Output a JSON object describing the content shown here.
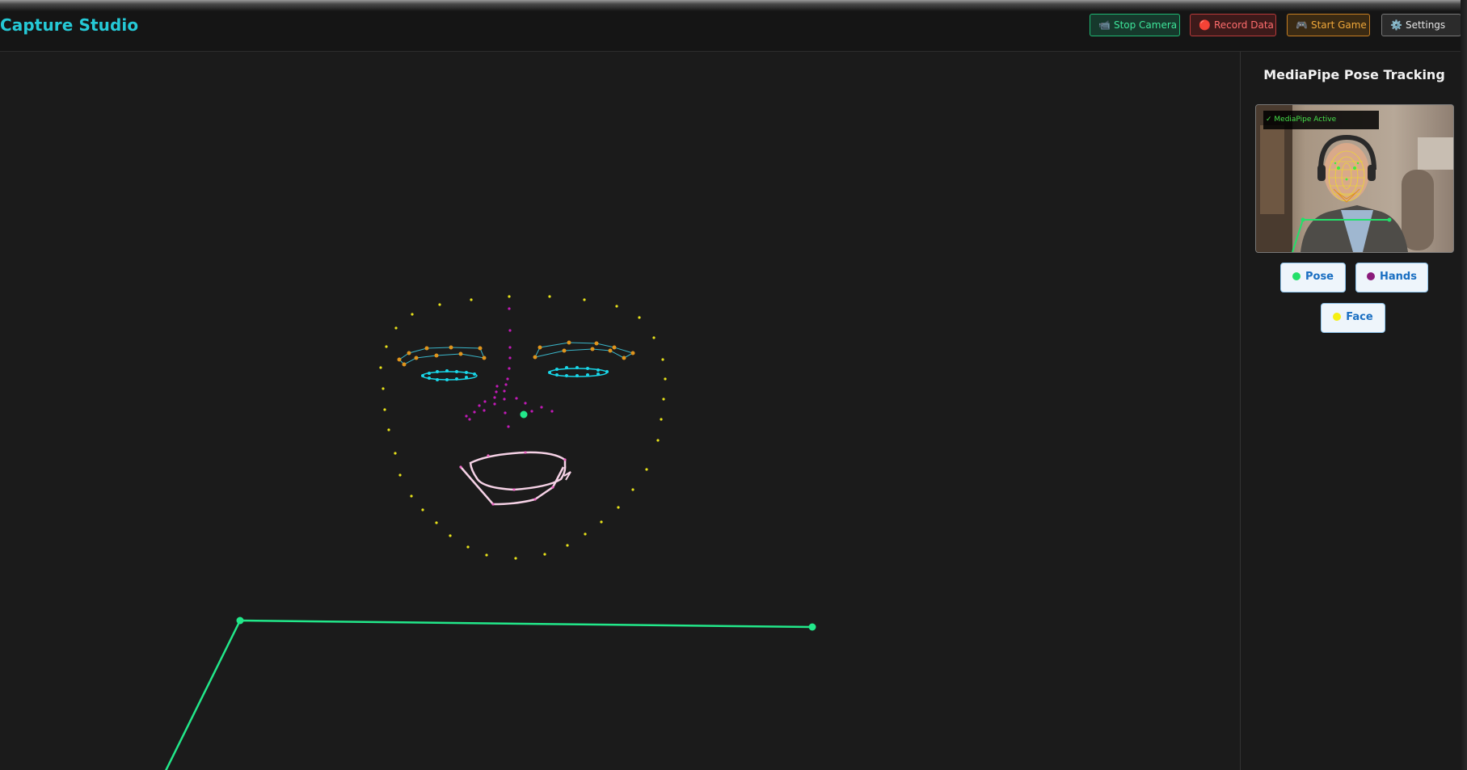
{
  "header": {
    "title": "Capture Studio",
    "buttons": {
      "stop_camera": {
        "icon": "📹",
        "label": "Stop Camera"
      },
      "record_data": {
        "icon": "🔴",
        "label": "Record Data"
      },
      "start_game": {
        "icon": "🎮",
        "label": "Start Game"
      },
      "settings": {
        "icon": "⚙️",
        "label": "Settings"
      }
    }
  },
  "panel": {
    "title": "MediaPipe Pose Tracking",
    "camera_status": "✓ MediaPipe Active",
    "toggles": {
      "pose": {
        "label": "Pose",
        "color": "#22e06a"
      },
      "hands": {
        "label": "Hands",
        "color": "#8a1a7a"
      },
      "face": {
        "label": "Face",
        "color": "#f5ef12"
      }
    }
  },
  "colors": {
    "accent": "#25c9d6",
    "pose": "#22e88a",
    "face_outline": "#e8e21a",
    "eyebrows": "#e0941c",
    "eyes": "#19d6e8",
    "nose": "#c21ab8",
    "mouth": "#f6d2e6"
  }
}
